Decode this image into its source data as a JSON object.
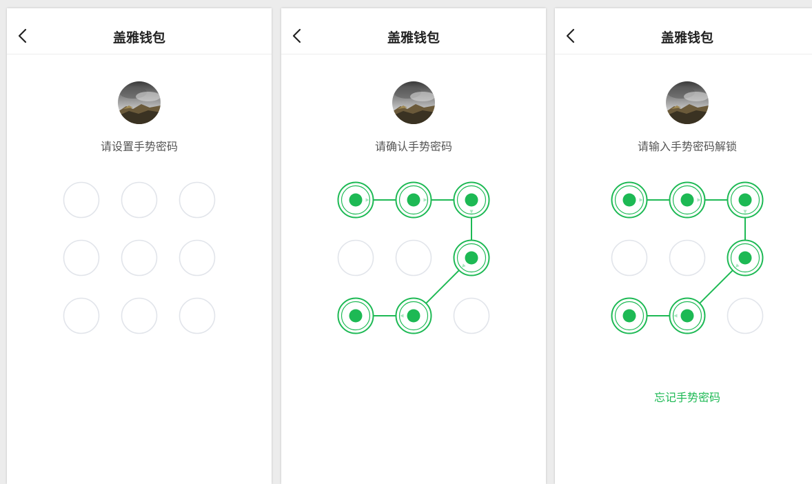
{
  "colors": {
    "accent": "#1db954",
    "accent_light": "#a8e6bf",
    "node_empty_border": "#e1e4ea",
    "title": "#222222",
    "prompt": "#555555"
  },
  "screens": [
    {
      "title": "盖雅钱包",
      "back_icon": "chevron-left-icon",
      "prompt": "请设置手势密码",
      "path": [],
      "forgot_label": null
    },
    {
      "title": "盖雅钱包",
      "back_icon": "chevron-left-icon",
      "prompt": "请确认手势密码",
      "path": [
        0,
        1,
        2,
        5,
        7,
        6
      ],
      "forgot_label": null
    },
    {
      "title": "盖雅钱包",
      "back_icon": "chevron-left-icon",
      "prompt": "请输入手势密码解锁",
      "path": [
        0,
        1,
        2,
        5,
        7,
        6
      ],
      "forgot_label": "忘记手势密码"
    }
  ]
}
